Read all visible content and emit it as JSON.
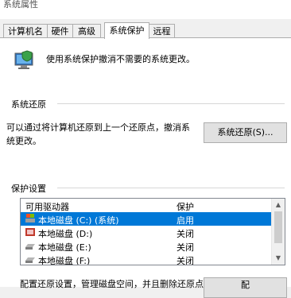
{
  "window": {
    "title": "系统属性"
  },
  "tabs": [
    {
      "label": "计算机名"
    },
    {
      "label": "硬件"
    },
    {
      "label": "高级"
    },
    {
      "label": "系统保护",
      "active": true
    },
    {
      "label": "远程"
    }
  ],
  "intro_text": "使用系统保护撤消不需要的系统更改。",
  "system_restore": {
    "heading": "系统还原",
    "description": "可以通过将计算机还原到上一个还原点，撤消系统更改。",
    "button_label": "系统还原(S)..."
  },
  "protection": {
    "heading": "保护设置",
    "columns": [
      "可用驱动器",
      "保护"
    ],
    "drives": [
      {
        "name": "本地磁盘 (C:) (系统)",
        "status": "启用",
        "icon": "system-drive-icon",
        "selected": true
      },
      {
        "name": "本地磁盘 (D:)",
        "status": "关闭",
        "icon": "drive-icon"
      },
      {
        "name": "本地磁盘 (E:)",
        "status": "关闭",
        "icon": "drive-icon"
      },
      {
        "name": "本地磁盘 (F:)",
        "status": "关闭",
        "icon": "drive-icon"
      }
    ],
    "config_text": "配置还原设置，管理磁盘空间，并且删除还原点。",
    "config_button_label": "配"
  },
  "colors": {
    "selection": "#0078d7",
    "panel": "#ffffff",
    "chrome": "#f0f0f0"
  }
}
